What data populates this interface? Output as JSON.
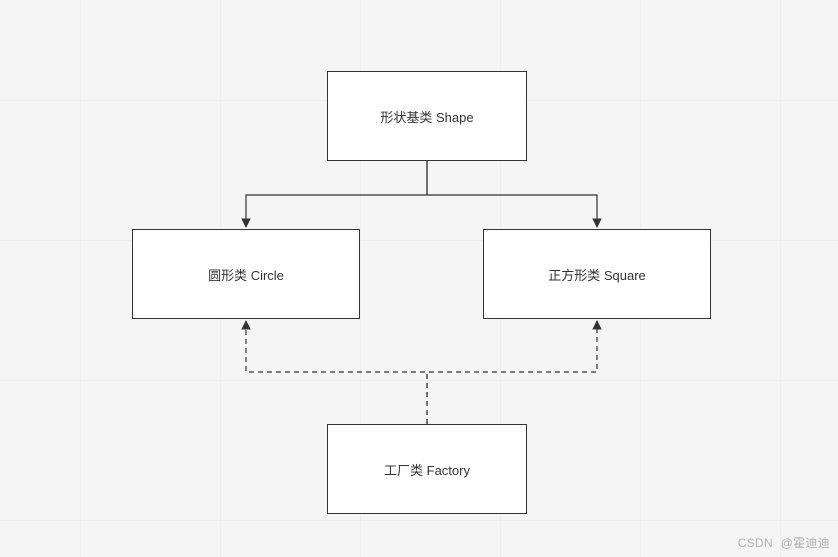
{
  "nodes": {
    "shape": {
      "label": "形状基类 Shape"
    },
    "circle": {
      "label": "圆形类 Circle"
    },
    "square": {
      "label": "正方形类 Square"
    },
    "factory": {
      "label": "工厂类 Factory"
    }
  },
  "watermark": {
    "prefix": "CSDN",
    "author": "@霍迪迪"
  },
  "chart_data": {
    "type": "diagram",
    "title": "",
    "nodes": [
      {
        "id": "shape",
        "label": "形状基类 Shape"
      },
      {
        "id": "circle",
        "label": "圆形类 Circle"
      },
      {
        "id": "square",
        "label": "正方形类 Square"
      },
      {
        "id": "factory",
        "label": "工厂类 Factory"
      }
    ],
    "edges": [
      {
        "from": "shape",
        "to": "circle",
        "style": "solid",
        "relation": "inheritance"
      },
      {
        "from": "shape",
        "to": "square",
        "style": "solid",
        "relation": "inheritance"
      },
      {
        "from": "factory",
        "to": "circle",
        "style": "dashed",
        "relation": "creates"
      },
      {
        "from": "factory",
        "to": "square",
        "style": "dashed",
        "relation": "creates"
      }
    ]
  }
}
